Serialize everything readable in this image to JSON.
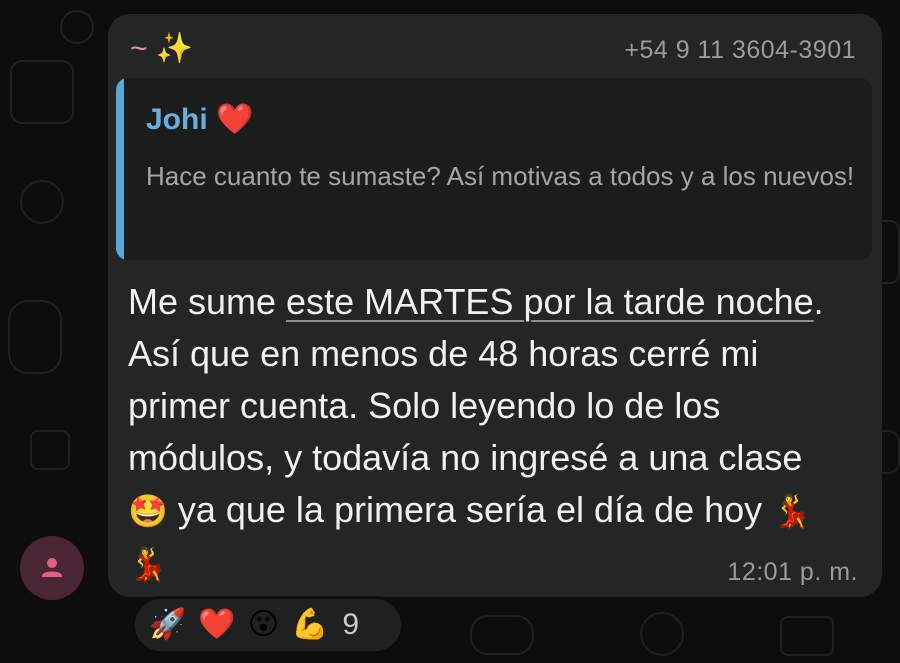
{
  "message": {
    "sender_name": "~ ✨",
    "sender_phone": "+54 9 11 3604-3901",
    "quote": {
      "author": "Johi ❤️",
      "text": "Hace cuanto te sumaste? Así motivas a todos y a los nuevos!"
    },
    "body": {
      "part1": "Me sume ",
      "link": "este MARTES por la tarde noche",
      "part2": ". Así que en menos de 48 horas cerré mi primer cuenta. Solo leyendo lo de los módulos, y todavía no ingresé a una clase ",
      "emoji1": "🤩",
      "part3": " ya que la primera sería el día de hoy ",
      "emoji2": "💃💃"
    },
    "timestamp": "12:01 p. m."
  },
  "reactions": {
    "emojis": [
      "🚀",
      "❤️",
      "😮",
      "💪"
    ],
    "count": "9"
  },
  "icons": {
    "avatar": "person-icon"
  },
  "colors": {
    "bubble": "#242626",
    "quote_bar": "#5ba7d8",
    "quote_author": "#6aaedc",
    "sender_name": "#e58fb7",
    "avatar_bg": "#4a2533",
    "avatar_icon": "#e0607f"
  }
}
